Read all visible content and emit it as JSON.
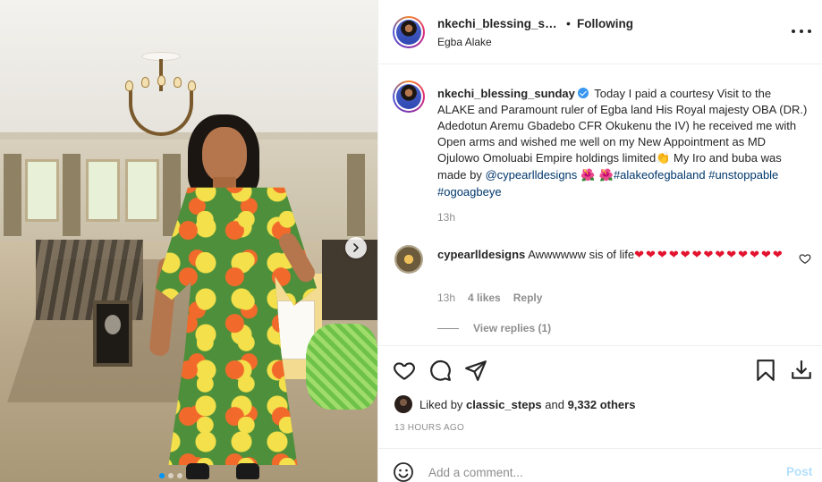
{
  "post": {
    "username": "nkechi_blessing_sunday",
    "username_truncated": "nkechi_blessing_sunda",
    "separator": "•",
    "follow_status": "Following",
    "location": "Egba Alake",
    "caption": {
      "username": "nkechi_blessing_sunday",
      "text_1": "Today I paid a courtesy Visit to the ALAKE and Paramount ruler of Egba land His Royal majesty OBA (DR.) Adedotun Aremu Gbadebo CFR Okukenu the IV) he received me with Open arms and wished me well on my New Appointment as MD Ojulowo Omoluabi Empire holdings limited",
      "emoji_1": "👏",
      "text_2": " My Iro and buba was made by ",
      "mention": "@cypearlldesigns",
      "emoji_2": " 🌺 🌺",
      "hashtag_1": "#alakeofegbaland",
      "hashtag_2": "#unstoppable",
      "hashtag_3": "#ogoagbeye",
      "time": "13h"
    },
    "comment": {
      "username": "cypearlldesigns",
      "text": "Awwwwww sis of life",
      "hearts": "❤❤❤❤❤❤❤❤❤❤❤❤❤",
      "time": "13h",
      "likes": "4 likes",
      "reply_label": "Reply",
      "view_replies": "View replies (1)"
    },
    "likes": {
      "liked_by_prefix": "Liked by ",
      "liked_by_user": "classic_steps",
      "and": " and ",
      "others": "9,332 others"
    },
    "timestamp": "13 HOURS AGO",
    "add_comment": {
      "placeholder": "Add a comment...",
      "post_label": "Post"
    }
  },
  "icons": {
    "like": "heart-icon",
    "comment": "comment-icon",
    "share": "share-icon",
    "save": "bookmark-icon",
    "download": "download-icon",
    "more": "more-icon",
    "emoji": "smile-icon",
    "next": "chevron-right-icon"
  },
  "colors": {
    "text": "#262626",
    "muted": "#8e8e8e",
    "link": "#00376b",
    "verified": "#3897f0",
    "heart": "#e3122e",
    "post_disabled": "#b2dffc",
    "carousel_active": "#0095f6"
  }
}
